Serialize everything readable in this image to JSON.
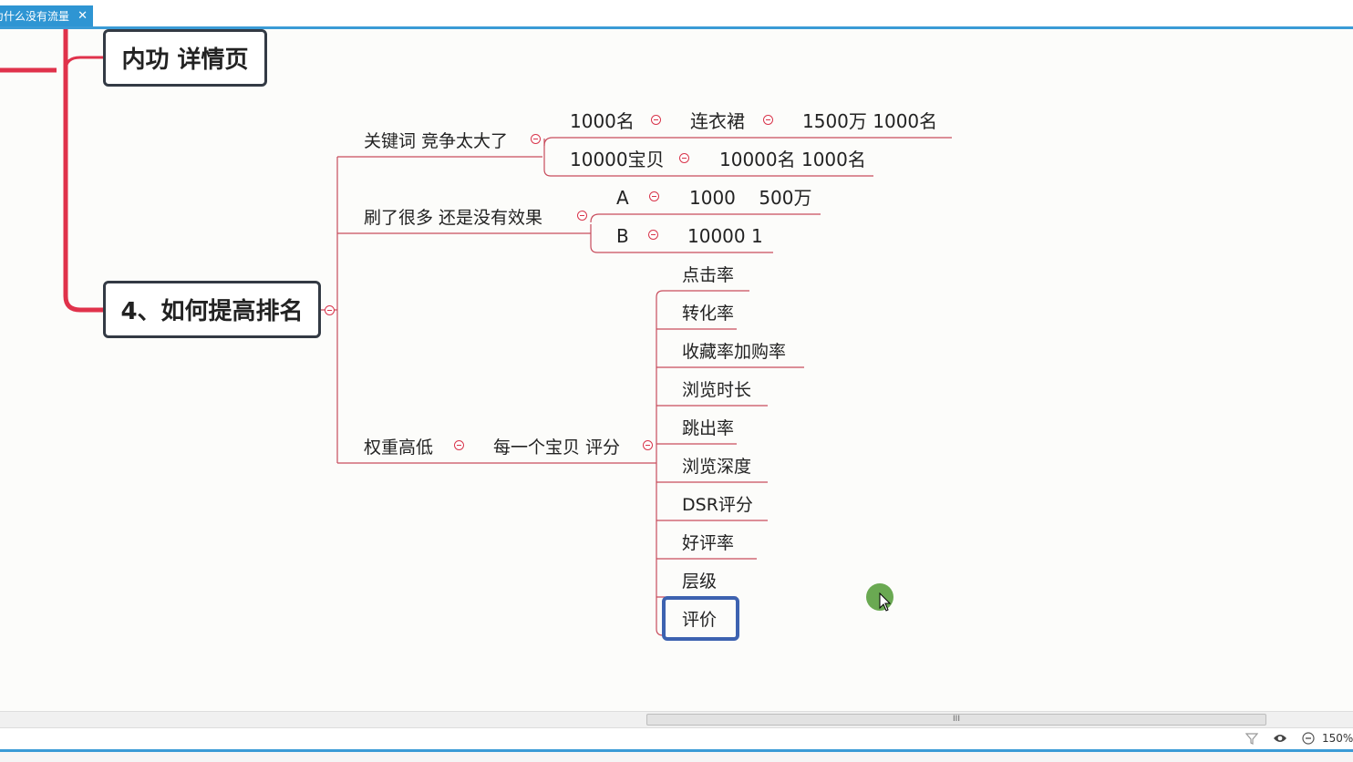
{
  "tab": {
    "title": "为什么没有流量",
    "close": "✕"
  },
  "colors": {
    "branch_red": "#e0324b",
    "thin_line": "#c84c5c",
    "tab_blue": "#2e95d3",
    "selection_blue": "#3d62b0"
  },
  "topics": {
    "neigong": "内功 详情页",
    "ranking": "4、如何提高排名"
  },
  "branches": {
    "keyword": "关键词 竞争太大了",
    "keyword_children": [
      {
        "a": "1000名",
        "b": "连衣裙",
        "c": "1500万 1000名"
      },
      {
        "a": "10000宝贝",
        "b": "10000名 1000名"
      }
    ],
    "brush": "刷了很多  还是没有效果",
    "brush_children": [
      {
        "a": "A",
        "b": "1000    500万"
      },
      {
        "a": "B",
        "b": "10000 1"
      }
    ],
    "weight": "权重高低",
    "score": "每一个宝贝 评分",
    "score_items": [
      "点击率",
      "转化率",
      "收藏率加购率",
      "浏览时长",
      "跳出率",
      "浏览深度",
      "DSR评分",
      "好评率",
      "层级",
      "评价"
    ]
  },
  "statusbar": {
    "zoom": "150%",
    "scroll_grip": "III",
    "filter_icon": "filter-icon",
    "eye_icon": "eye-icon",
    "zoom_out_icon": "zoom-out-icon"
  }
}
